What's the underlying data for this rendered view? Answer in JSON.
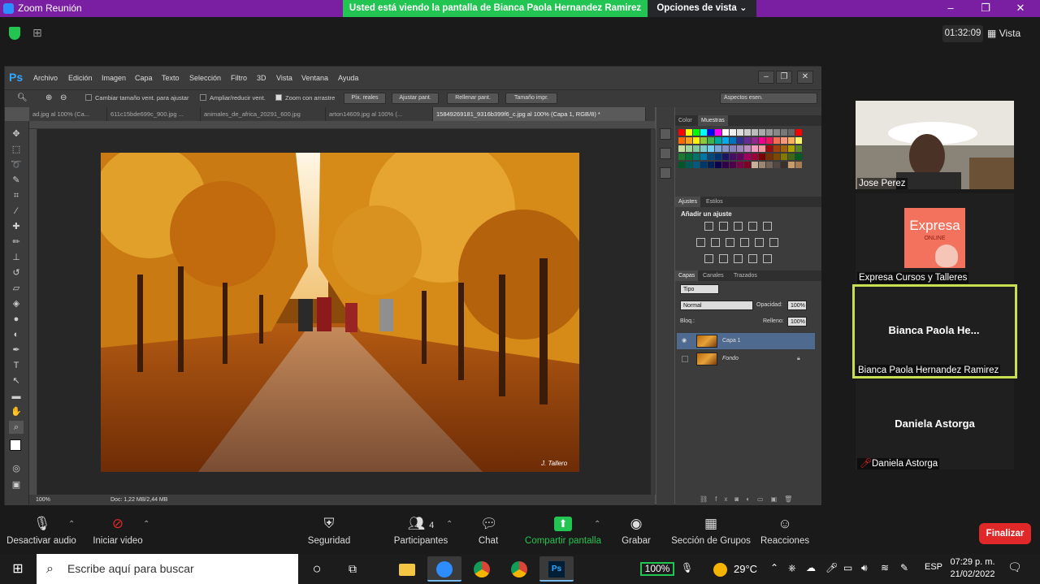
{
  "zoom": {
    "app_title": "Zoom Reunión",
    "share_banner": "Usted está viendo la pantalla de Bianca Paola Hernandez Ramirez",
    "view_options": "Opciones de vista",
    "timer": "01:32:09",
    "view_label": "Vista",
    "participants": [
      {
        "name": "Jose Perez",
        "type": "video"
      },
      {
        "name": "Expresa Cursos y Talleres",
        "type": "logo",
        "logo_text": "Expresa",
        "logo_sub": "ONLINE"
      },
      {
        "name": "Bianca Paola Hernandez Ramirez",
        "big_label": "Bianca  Paola  He...",
        "speaking": true
      },
      {
        "name": "Daniela Astorga",
        "big_label": "Daniela Astorga",
        "muted": true
      }
    ],
    "toolbar": {
      "mute_audio": "Desactivar audio",
      "start_video": "Iniciar video",
      "security": "Seguridad",
      "participants": "Participantes",
      "participants_count": "4",
      "chat": "Chat",
      "share_screen": "Compartir pantalla",
      "record": "Grabar",
      "breakout": "Sección de Grupos",
      "reactions": "Reacciones",
      "end": "Finalizar"
    },
    "colors": {
      "title_bar": "#7a1fa2",
      "banner": "#23c552",
      "speaker_border": "#c8e04f",
      "end": "#e02828"
    }
  },
  "photoshop": {
    "logo": "Ps",
    "menu": [
      "Archivo",
      "Edición",
      "Imagen",
      "Capa",
      "Texto",
      "Selección",
      "Filtro",
      "3D",
      "Vista",
      "Ventana",
      "Ayuda"
    ],
    "options": {
      "resize_windows": "Cambiar tamaño vent. para ajustar",
      "zoom_all": "Ampliar/reducir vent.",
      "scrubby_zoom": "Zoom con arrastre",
      "actual_pixels": "Píx. reales",
      "fit_screen": "Ajustar pant.",
      "fill_screen": "Rellenar pant.",
      "print_size": "Tamaño impr.",
      "workspace": "Aspectos esen."
    },
    "tabs": [
      "ad.jpg al 100% (Ca...",
      "611c15bde699c_900.jpg ...",
      "animales_de_africa_20291_600.jpg",
      "arton14609.jpg al 100% (...",
      "15849269181_9316b399f6_c.jpg al 100% (Capa 1, RGB/8) *"
    ],
    "status": {
      "zoom": "100%",
      "doc": "Doc: 1,22 MB/2,44 MB"
    },
    "photo_caption": "J. Tallero",
    "panels": {
      "color_tab": "Color",
      "swatches_tab": "Muestras",
      "adjust_tab": "Ajustes",
      "styles_tab": "Estilos",
      "add_adjust": "Añadir un ajuste",
      "layers_tab": "Capas",
      "channels_tab": "Canales",
      "paths_tab": "Trazados",
      "kind": "Tipo",
      "blend": "Normal",
      "opacity_label": "Opacidad:",
      "opacity": "100%",
      "lock_label": "Bloq.:",
      "fill_label": "Relleno:",
      "fill": "100%",
      "layers": [
        {
          "name": "Capa 1",
          "selected": true
        },
        {
          "name": "Fondo",
          "selected": false,
          "locked": true
        }
      ]
    }
  },
  "taskbar": {
    "search_placeholder": "Escribe aquí para buscar",
    "battery": "100%",
    "temperature": "29°C",
    "lang": "ESP",
    "time": "07:29 p. m.",
    "date": "21/02/2022"
  }
}
